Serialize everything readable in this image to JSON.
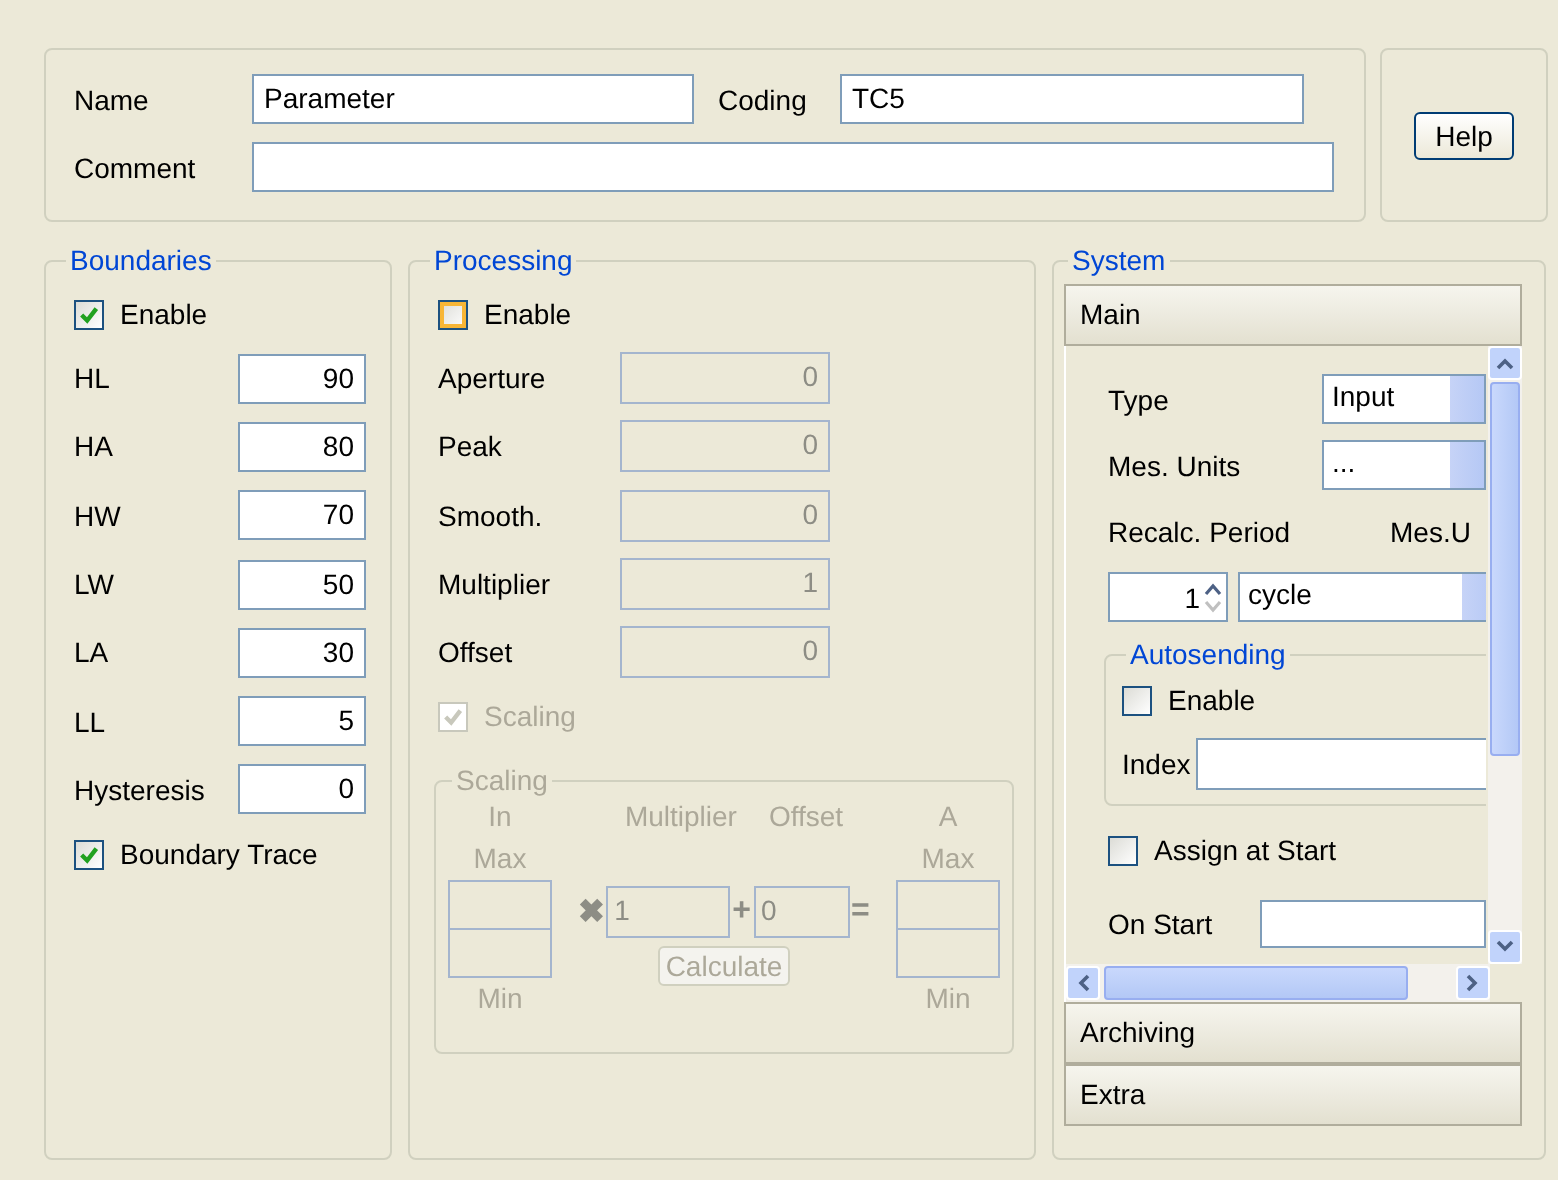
{
  "header": {
    "name_label": "Name",
    "name_value": "Parameter",
    "coding_label": "Coding",
    "coding_value": "TC5",
    "comment_label": "Comment",
    "help_button": "Help"
  },
  "boundaries": {
    "title": "Boundaries",
    "enable": {
      "label": "Enable",
      "checked": true
    },
    "fields": [
      {
        "label": "HL",
        "value": "90"
      },
      {
        "label": "HA",
        "value": "80"
      },
      {
        "label": "HW",
        "value": "70"
      },
      {
        "label": "LW",
        "value": "50"
      },
      {
        "label": "LA",
        "value": "30"
      },
      {
        "label": "LL",
        "value": "5"
      },
      {
        "label": "Hysteresis",
        "value": "0"
      }
    ],
    "boundary_trace": {
      "label": "Boundary Trace",
      "checked": true
    }
  },
  "processing": {
    "title": "Processing",
    "enable": {
      "label": "Enable",
      "checked": false,
      "hovered": true
    },
    "fields": [
      {
        "label": "Aperture",
        "value": "0",
        "disabled": true
      },
      {
        "label": "Peak",
        "value": "0",
        "disabled": true
      },
      {
        "label": "Smooth.",
        "value": "0",
        "disabled": true
      },
      {
        "label": "Multiplier",
        "value": "1",
        "disabled": true
      },
      {
        "label": "Offset",
        "value": "0",
        "disabled": true
      }
    ],
    "scaling_check": {
      "label": "Scaling",
      "checked": true,
      "disabled": true
    },
    "scaling": {
      "title": "Scaling",
      "in_label": "In",
      "multiplier_label": "Multiplier",
      "offset_label": "Offset",
      "a_label": "A",
      "in_max": "Max",
      "in_min": "Min",
      "times": "✖",
      "multiplier_value": "1",
      "plus": "+",
      "offset_value": "0",
      "equals": "=",
      "out_max": "Max",
      "out_min": "Min",
      "calculate_button": "Calculate"
    }
  },
  "system": {
    "title": "System",
    "sections": [
      {
        "label": "Main",
        "expanded": true
      },
      {
        "label": "Archiving",
        "expanded": false
      },
      {
        "label": "Extra",
        "expanded": false
      }
    ],
    "main": {
      "type_label": "Type",
      "type_value": "Input",
      "units_label": "Mes. Units",
      "units_value": "...",
      "recalc_label": "Recalc. Period",
      "mesu_label": "Mes.U",
      "period_value": "1",
      "period_unit": "cycle",
      "autosending": {
        "title": "Autosending",
        "enable": {
          "label": "Enable",
          "checked": false
        },
        "index_label": "Index"
      },
      "assign_at_start": {
        "label": "Assign at Start",
        "checked": false
      },
      "on_start_label": "On Start"
    }
  }
}
